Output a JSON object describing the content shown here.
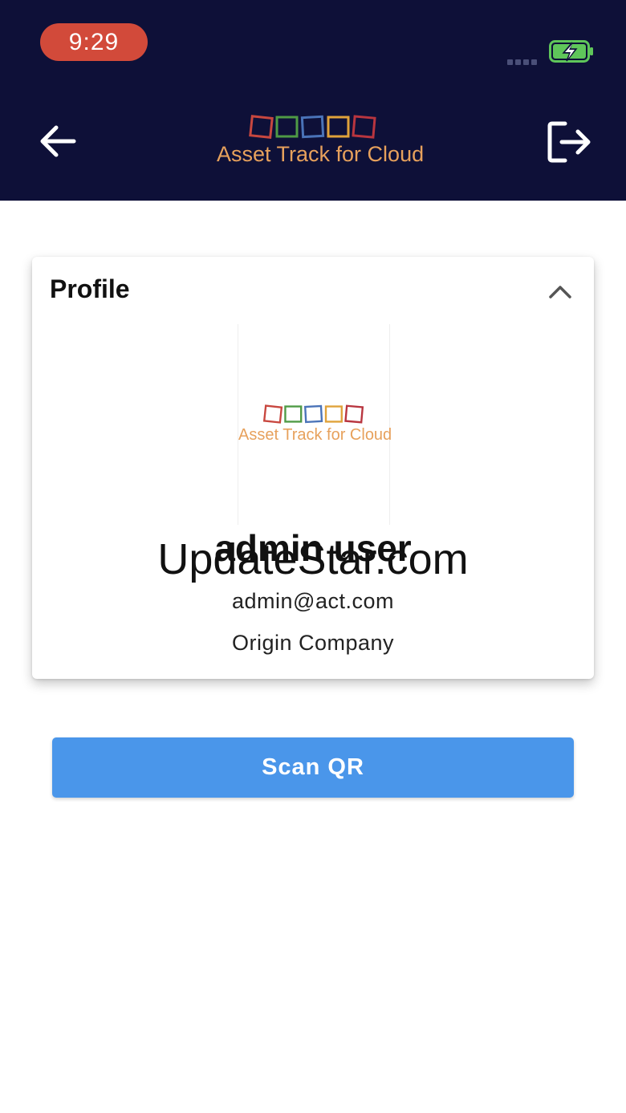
{
  "status_bar": {
    "time": "9:29"
  },
  "header": {
    "app_name": "Asset Track for Cloud",
    "logo_colors": [
      "#c8473f",
      "#4f9a45",
      "#4a73b8",
      "#e0a23a",
      "#b8353f"
    ],
    "back_icon": "arrow-left-icon",
    "logout_icon": "logout-icon"
  },
  "profile": {
    "title": "Profile",
    "collapse_icon": "chevron-up-icon",
    "avatar_logo_text": "Asset Track for Cloud",
    "name": "admin user",
    "email": "admin@act.com",
    "company": "Origin Company"
  },
  "watermark": "UpdateStar.com",
  "actions": {
    "scan_label": "Scan QR"
  },
  "colors": {
    "header_bg": "#0e1038",
    "accent": "#4a96ea",
    "time_pill": "#d24a3a",
    "logo_text": "#e7a15c"
  }
}
